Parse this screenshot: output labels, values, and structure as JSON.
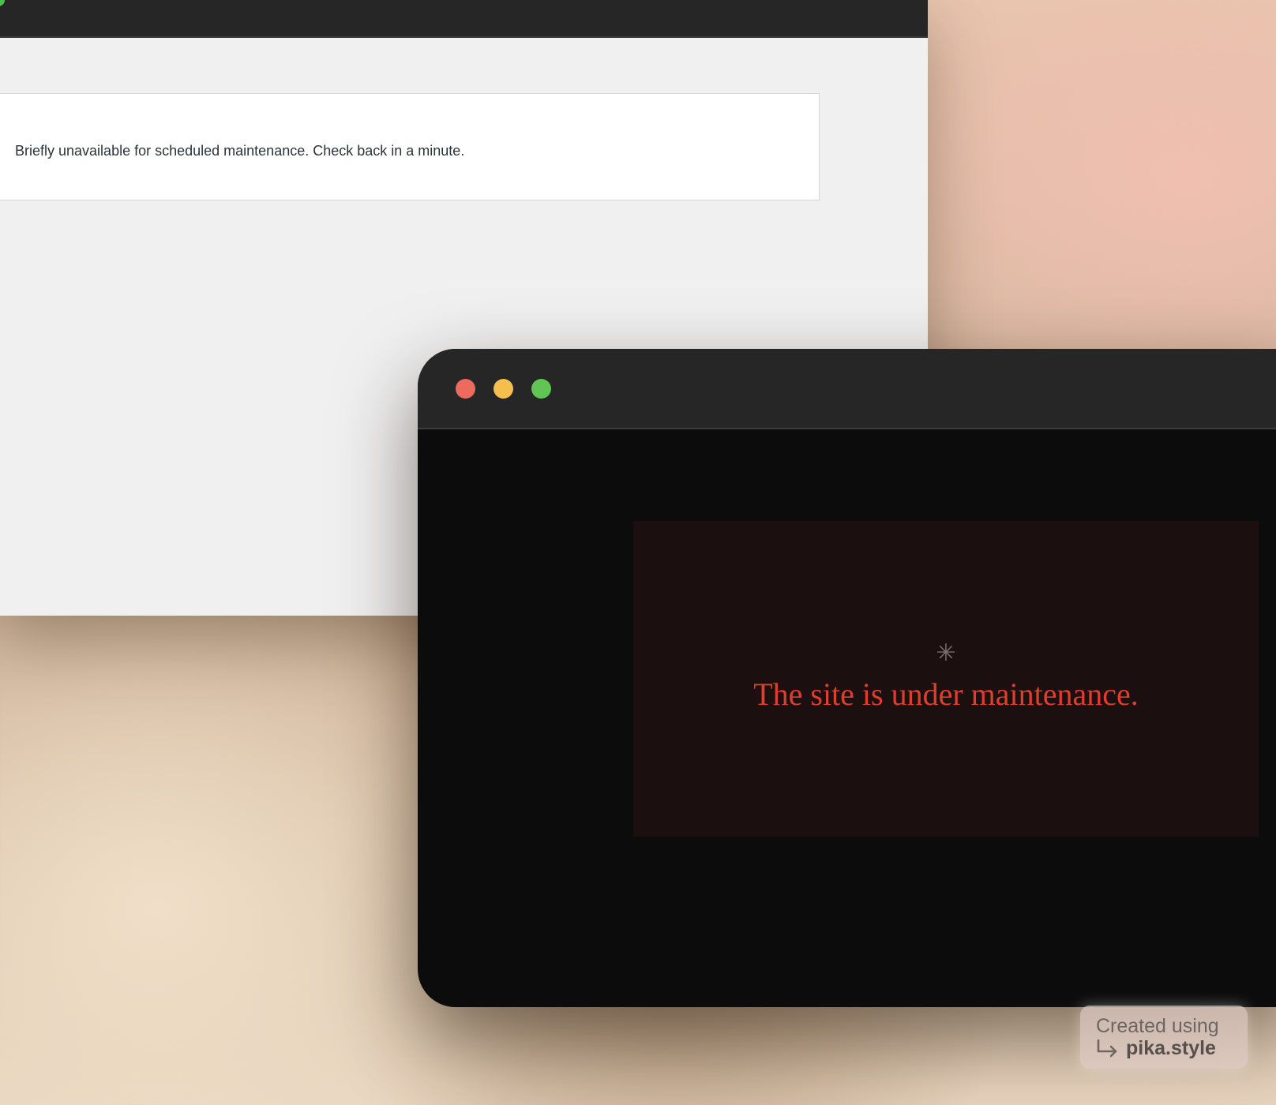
{
  "back_window": {
    "notice": "Briefly unavailable for scheduled maintenance. Check back in a minute."
  },
  "front_window": {
    "traffic_lights": {
      "close": "#ec6a5e",
      "minimize": "#f4bf4f",
      "maximize": "#61c554"
    },
    "icon": "asterisk-icon",
    "asterisk_glyph": "✳",
    "message": "The site is under maintenance.",
    "message_color": "#df3d2e"
  },
  "watermark": {
    "line1": "Created using",
    "line2": "pika.style",
    "arrow_icon": "return-arrow-icon"
  }
}
